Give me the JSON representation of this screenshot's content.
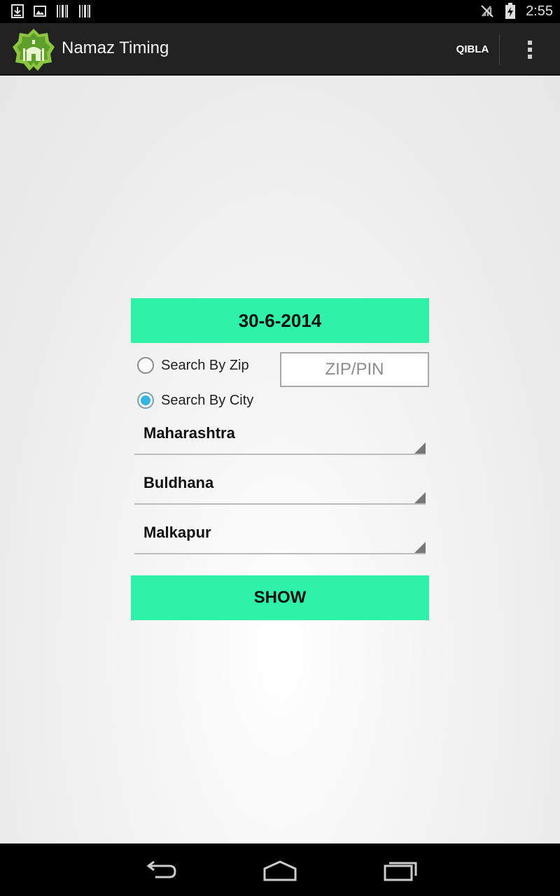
{
  "status_bar": {
    "time": "2:55",
    "left_icons": [
      "download-icon",
      "image-icon",
      "barcode-icon",
      "barcode-icon"
    ],
    "right_icons": [
      "signal-off-icon",
      "battery-charging-icon"
    ]
  },
  "action_bar": {
    "title": "Namaz Timing",
    "qibla_label": "QIBLA",
    "logo_icon": "mosque-logo-icon",
    "overflow_icon": "overflow-menu-icon"
  },
  "form": {
    "date": "30-6-2014",
    "radio_zip_label": "Search By Zip",
    "radio_city_label": "Search By City",
    "selected_radio": "city",
    "zip_placeholder": "ZIP/PIN",
    "zip_value": "",
    "state_value": "Maharashtra",
    "district_value": "Buldhana",
    "city_value": "Malkapur",
    "show_label": "SHOW"
  },
  "nav_bar": {
    "icons": [
      "back-icon",
      "home-icon",
      "recents-icon"
    ]
  },
  "colors": {
    "accent": "#2ef2a8",
    "action_bar": "#222222",
    "radio_checked": "#33b5e5"
  }
}
